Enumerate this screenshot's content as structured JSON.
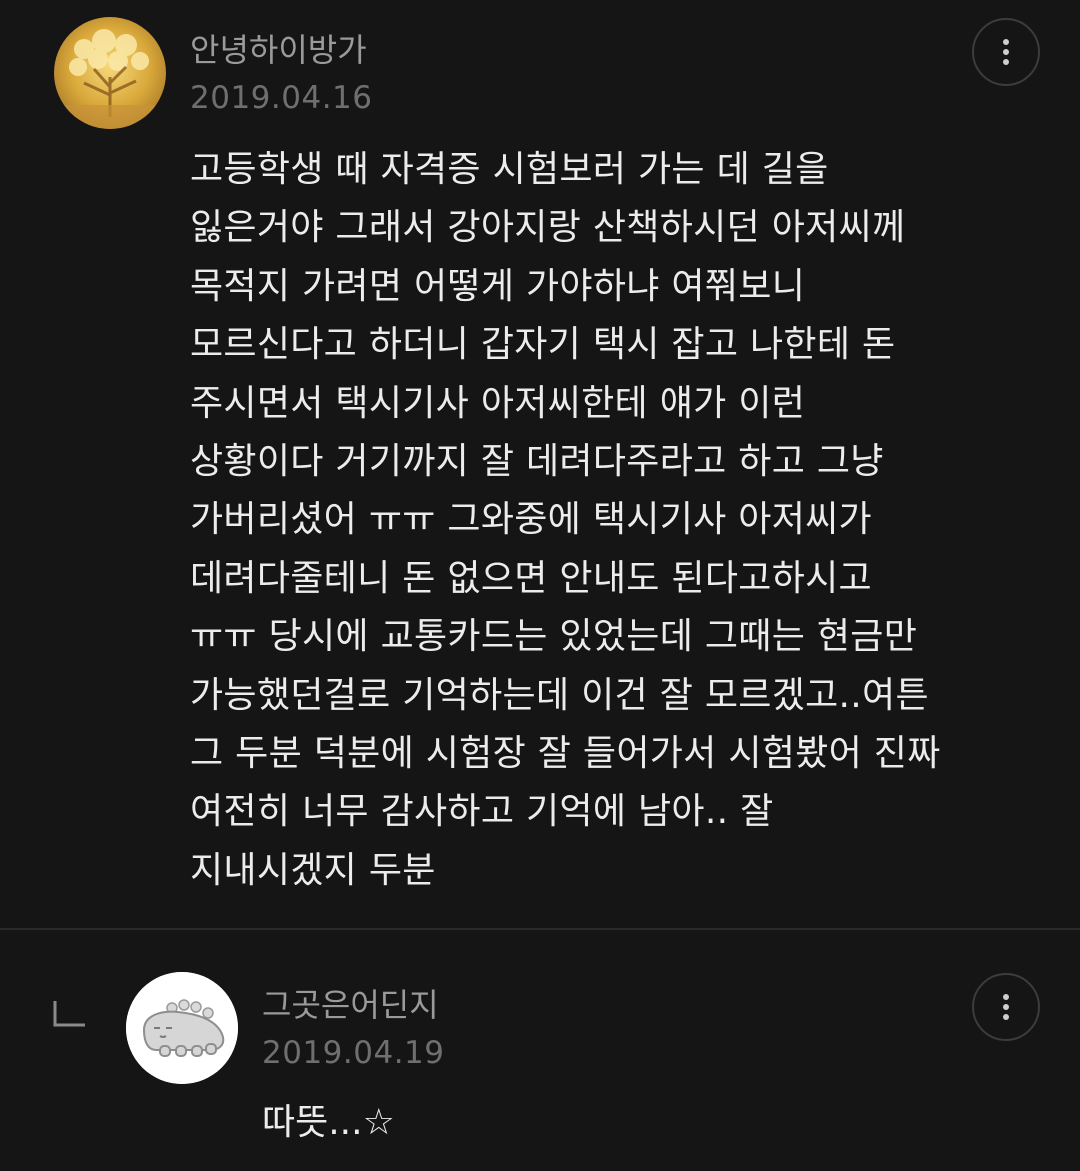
{
  "comment": {
    "username": "안녕하이방가",
    "date": "2019.04.16",
    "avatar_icon": "golden-tree-avatar",
    "more_icon": "more-vertical-icon",
    "lines": [
      "고등학생 때 자격증 시험보러 가는 데 길을",
      "잃은거야 그래서 강아지랑 산책하시던 아저씨께",
      "목적지 가려면 어떻게 가야하냐 여쭤보니",
      "모르신다고 하더니 갑자기 택시 잡고 나한테 돈",
      "주시면서 택시기사 아저씨한테 얘가 이런",
      "상황이다 거기까지 잘 데려다주라고 하고 그냥",
      "가버리셨어 ㅠㅠ 그와중에 택시기사 아저씨가",
      "데려다줄테니 돈 없으면 안내도 된다고하시고",
      "ㅠㅠ 당시에 교통카드는 있었는데 그때는 현금만",
      "가능했던걸로 기억하는데 이건 잘 모르겠고..여튼",
      "그 두분 덕분에 시험장 잘 들어가서 시험봤어 진짜",
      "여전히 너무 감사하고 기억에 남아.. 잘",
      "지내시겠지 두분"
    ]
  },
  "reply": {
    "username": "그곳은어딘지",
    "date": "2019.04.19",
    "avatar_icon": "dinosaur-character-avatar",
    "reply_icon": "reply-arrow-icon",
    "more_icon": "more-vertical-icon",
    "text": "따뜻...☆"
  },
  "colors": {
    "background": "#151515",
    "text_primary": "#ececec",
    "text_username": "#9a9a9a",
    "text_date": "#6f6f6f",
    "divider": "#2a2a2a"
  }
}
